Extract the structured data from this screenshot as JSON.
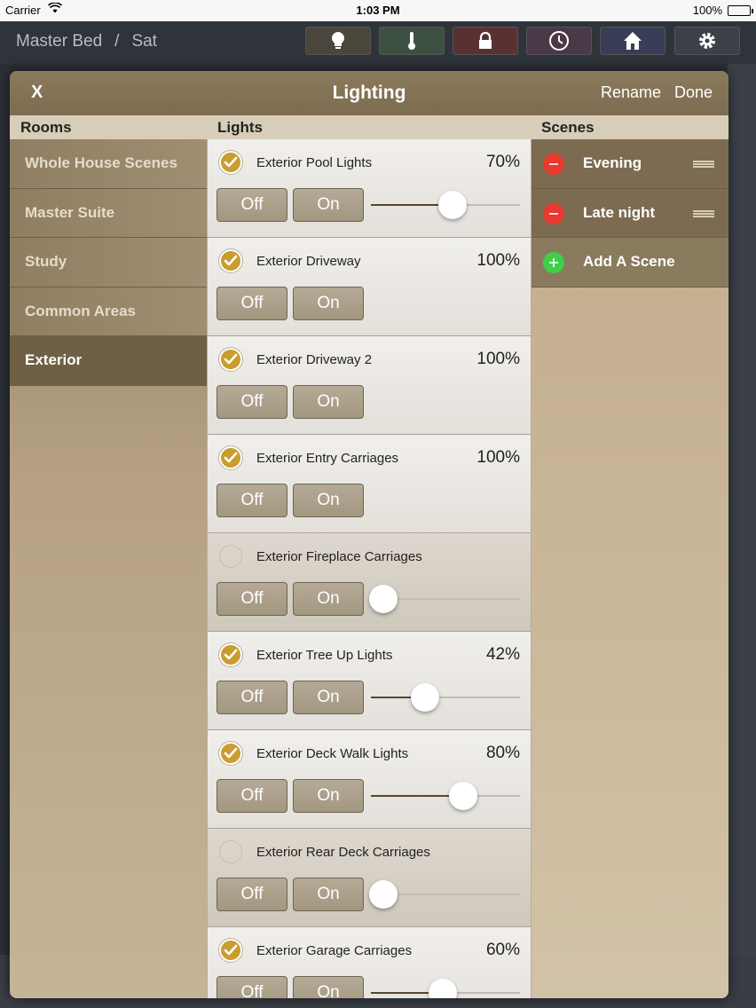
{
  "status_bar": {
    "carrier": "Carrier",
    "time": "1:03 PM",
    "battery": "100%"
  },
  "topnav": {
    "room": "Master Bed",
    "separator": "/",
    "day": "Sat",
    "buttons": [
      {
        "icon": "lightbulb-icon",
        "color": "#4a463c"
      },
      {
        "icon": "thermometer-icon",
        "color": "#3d5143"
      },
      {
        "icon": "lock-icon",
        "color": "#5a3133"
      },
      {
        "icon": "clock-icon",
        "color": "#4a3947"
      },
      {
        "icon": "home-icon",
        "color": "#393d55"
      },
      {
        "icon": "gear-icon",
        "color": "#3d4047"
      }
    ]
  },
  "modal": {
    "close": "X",
    "title": "Lighting",
    "rename": "Rename",
    "done": "Done"
  },
  "columns": {
    "rooms": "Rooms",
    "lights": "Lights",
    "scenes": "Scenes"
  },
  "rooms": [
    {
      "label": "Whole House Scenes",
      "selected": false
    },
    {
      "label": "Master Suite",
      "selected": false
    },
    {
      "label": "Study",
      "selected": false
    },
    {
      "label": "Common Areas",
      "selected": false
    },
    {
      "label": "Exterior",
      "selected": true
    }
  ],
  "lights": [
    {
      "name": "Exterior Pool Lights",
      "checked": true,
      "percent_label": "70%",
      "level": 0.7,
      "dimmer": true
    },
    {
      "name": "Exterior Driveway",
      "checked": true,
      "percent_label": "100%",
      "level": 1.0,
      "dimmer": false
    },
    {
      "name": "Exterior Driveway 2",
      "checked": true,
      "percent_label": "100%",
      "level": 1.0,
      "dimmer": false
    },
    {
      "name": "Exterior Entry Carriages",
      "checked": true,
      "percent_label": "100%",
      "level": 1.0,
      "dimmer": false
    },
    {
      "name": "Exterior Fireplace Carriages",
      "checked": false,
      "percent_label": "",
      "level": 0.0,
      "dimmer": true
    },
    {
      "name": "Exterior Tree Up Lights",
      "checked": true,
      "percent_label": "42%",
      "level": 0.42,
      "dimmer": true
    },
    {
      "name": "Exterior Deck Walk Lights",
      "checked": true,
      "percent_label": "80%",
      "level": 0.8,
      "dimmer": true
    },
    {
      "name": "Exterior Rear Deck Carriages",
      "checked": false,
      "percent_label": "",
      "level": 0.0,
      "dimmer": true
    },
    {
      "name": "Exterior Garage Carriages",
      "checked": true,
      "percent_label": "60%",
      "level": 0.6,
      "dimmer": true
    }
  ],
  "light_buttons": {
    "off": "Off",
    "on": "On"
  },
  "scenes": [
    {
      "label": "Evening",
      "type": "remove"
    },
    {
      "label": "Late night",
      "type": "remove"
    },
    {
      "label": "Add A Scene",
      "type": "add"
    }
  ]
}
